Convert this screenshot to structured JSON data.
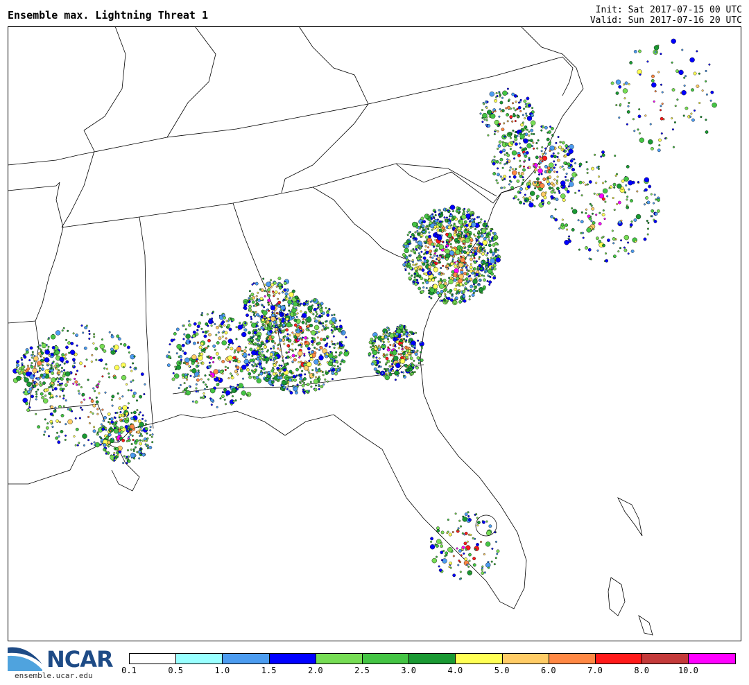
{
  "header": {
    "title": "Ensemble max. Lightning Threat 1",
    "init": "Init: Sat 2017-07-15 00 UTC",
    "valid": "Valid: Sun 2017-07-16 20 UTC"
  },
  "logo": {
    "text": "NCAR",
    "url": "ensemble.ucar.edu",
    "color": "#1e4b86"
  },
  "colorbar": {
    "colors": [
      "#ffffff",
      "#99ffff",
      "#4c9cf0",
      "#0000ff",
      "#77dd55",
      "#44c444",
      "#1a9933",
      "#ffff55",
      "#ffcc66",
      "#ff8844",
      "#ff1a1a",
      "#c43a3a",
      "#ff00ff"
    ],
    "labels": [
      "0.1",
      "0.5",
      "1.0",
      "1.5",
      "2.0",
      "2.5",
      "3.0",
      "4.0",
      "5.0",
      "6.0",
      "7.0",
      "8.0",
      "10.0"
    ]
  }
}
